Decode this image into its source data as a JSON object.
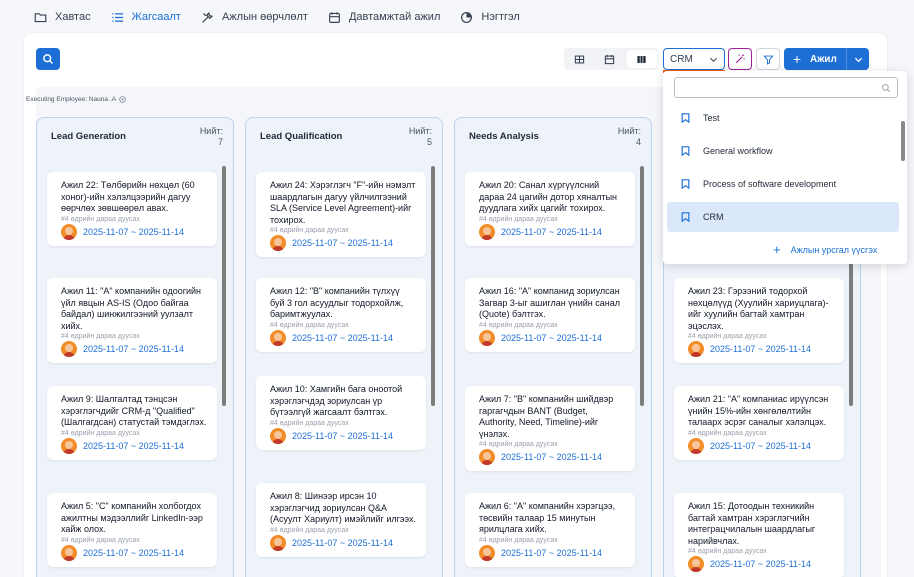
{
  "tabs": [
    {
      "label": "Хавтас",
      "icon": "folder-icon",
      "active": false
    },
    {
      "label": "Жагсаалт",
      "icon": "list-icon",
      "active": true
    },
    {
      "label": "Ажлын өөрчлөлт",
      "icon": "tools-icon",
      "active": false
    },
    {
      "label": "Давтамжтай ажил",
      "icon": "calendar-icon",
      "active": false
    },
    {
      "label": "Нэгтгэл",
      "icon": "pie-chart-icon",
      "active": false
    }
  ],
  "toolbar": {
    "workflow_value": "CRM",
    "add_label": "Ажил"
  },
  "exec_label": "Executing Employee: Nauna .A",
  "count_label": "Нийт:",
  "columns": [
    {
      "title": "Lead Generation",
      "count": "7",
      "cards": [
        {
          "title": "Ажил 22: Төлбөрийн нөхцөл (60 хоног)-ийн хэлэлцээрийн дагуу өөрчлөх зөвшөөрөл авах.",
          "meta": "#4 өдрийн дараа дуусах",
          "date": "2025-11-07 ~ 2025-11-14"
        },
        {
          "title": "Ажил 11: \"А\" компанийн одоогийн үйл явцын AS-IS (Одоо байгаа байдал) шинжилгээний уулзалт хийх.",
          "meta": "#4 өдрийн дараа дуусах",
          "date": "2025-11-07 ~ 2025-11-14"
        },
        {
          "title": "Ажил 9: Шалгалтад тэнцсэн хэрэглэгчдийг CRM-д \"Qualified\" (Шалгагдсан) статустай тэмдэглэх.",
          "meta": "#4 өдрийн дараа дуусах",
          "date": "2025-11-07 ~ 2025-11-14"
        },
        {
          "title": "Ажил 5: \"С\" компанийн холбогдох ажилтны мэдээллийг LinkedIn-ээр хайж олох.",
          "meta": "#4 өдрийн дараа дуусах",
          "date": "2025-11-07 ~ 2025-11-14"
        }
      ]
    },
    {
      "title": "Lead Qualification",
      "count": "5",
      "cards": [
        {
          "title": "Ажил 24: Хэрэглэгч \"F\"-ийн нэмэлт шаардлагын дагуу үйлчилгээний SLA (Service Level Agreement)-ийг тохирох.",
          "meta": "#4 өдрийн дараа дуусах",
          "date": "2025-11-07 ~ 2025-11-14"
        },
        {
          "title": "Ажил 12: \"В\" компанийн түлхүү буй 3 гол асуудлыг тодорхойлж, баримтжуулах.",
          "meta": "#4 өдрийн дараа дуусах",
          "date": "2025-11-07 ~ 2025-11-14"
        },
        {
          "title": "Ажил 10: Хамгийн бага оноотой хэрэглэгчдэд зориулсан үр бүтээлгүй жагсаалт бэлтгэх.",
          "meta": "#4 өдрийн дараа дуусах",
          "date": "2025-11-07 ~ 2025-11-14"
        },
        {
          "title": "Ажил 8: Шинээр ирсэн 10 хэрэглэгчид зориулсан Q&A (Асуулт Хариулт) имэйлийг илгээх.",
          "meta": "#4 өдрийн дараа дуусах",
          "date": "2025-11-07 ~ 2025-11-14"
        }
      ]
    },
    {
      "title": "Needs Analysis",
      "count": "4",
      "cards": [
        {
          "title": "Ажил 20: Санал хүргүүлсний дараа 24 цагийн дотор хяналтын дуудлага хийх цагийг тохирох.",
          "meta": "#4 өдрийн дараа дуусах",
          "date": "2025-11-07 ~ 2025-11-14"
        },
        {
          "title": "Ажил 16: \"А\" компанид зориулсан Загвар 3-ыг ашиглан үнийн санал (Quote) бэлтгэх.",
          "meta": "#4 өдрийн дараа дуусах",
          "date": "2025-11-07 ~ 2025-11-14"
        },
        {
          "title": "Ажил 7: \"В\" компанийн шийдвэр гаргагчдын BANT (Budget, Authority, Need, Timeline)-ийг үнэлэх.",
          "meta": "#4 өдрийн дараа дуусах",
          "date": "2025-11-07 ~ 2025-11-14"
        },
        {
          "title": "Ажил 6: \"А\" компанийн хэрэгцээ, төсвийн талаар 15 минутын ярилцлага хийх.",
          "meta": "#4 өдрийн дараа дуусах",
          "date": "2025-11-07 ~ 2025-11-14"
        }
      ]
    },
    {
      "title": "",
      "count": "",
      "cards": [
        {
          "title": "",
          "meta": "",
          "date": ""
        },
        {
          "title": "Ажил 23: Гэрээний тодорхой нөхцөлүүд (Хуулийн хариуцлага)-ийг хуулийн багтай хамтран эцэслэх.",
          "meta": "#4 өдрийн дараа дуусах",
          "date": "2025-11-07 ~ 2025-11-14"
        },
        {
          "title": "Ажил 21: \"А\" компаниас ирүүлсэн үнийн 15%-ийн хөнгөлөлтийн талаарх эсрэг саналыг хэлэлцэх.",
          "meta": "#4 өдрийн дараа дуусах",
          "date": "2025-11-07 ~ 2025-11-14"
        },
        {
          "title": "Ажил 15: Дотоодын техникийн багтай хамтран хэрэглэгчийн интеграцчилалын шаардлагыг нарийвчлах.",
          "meta": "#4 өдрийн дараа дуусах",
          "date": "2025-11-07 ~ 2025-11-14"
        }
      ]
    }
  ],
  "dropdown": {
    "search_placeholder": "",
    "items": [
      "Test",
      "General workflow",
      "Process of software development",
      "CRM"
    ],
    "selected": "CRM",
    "add_label": "Ажлын урсгал үүсгэх"
  },
  "colors": {
    "accent": "#1d6fd6",
    "orange": "#f05a1a",
    "magic": "#a020a0"
  }
}
